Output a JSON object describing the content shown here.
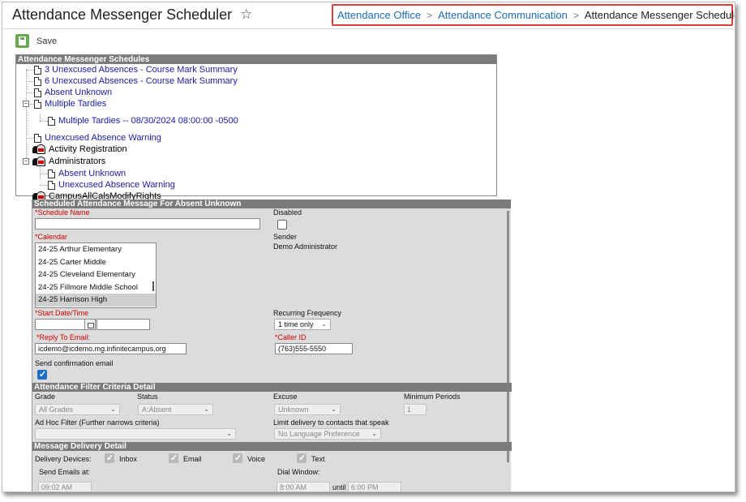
{
  "header": {
    "title": "Attendance Messenger Scheduler",
    "breadcrumb": [
      "Attendance Office",
      "Attendance Communication"
    ],
    "breadcrumb_current": "Attendance Messenger Scheduler"
  },
  "toolbar": {
    "save_label": "Save"
  },
  "schedules": {
    "header": "Attendance Messenger Schedules",
    "items": [
      {
        "label": "3 Unexcused Absences - Course Mark Summary"
      },
      {
        "label": "6 Unexcused Absences - Course Mark Summary"
      },
      {
        "label": "Absent Unknown"
      },
      {
        "label": "Multiple Tardies"
      },
      {
        "label": "Multiple Tardies -- 08/30/2024 08:00:00 -0500"
      },
      {
        "label": "Unexcused Absence Warning"
      },
      {
        "label": "Activity Registration"
      },
      {
        "label": "Administrators"
      },
      {
        "label": "Absent Unknown"
      },
      {
        "label": "Unexcused Absence Warning"
      },
      {
        "label": "CampusAllCalsModifyRights"
      }
    ]
  },
  "detail": {
    "header": "Scheduled Attendance Message For Absent Unknown",
    "schedule_name_label": "*Schedule Name",
    "schedule_name_value": "",
    "disabled_label": "Disabled",
    "calendar_label": "*Calendar",
    "calendars": [
      "24-25 Arthur Elementary",
      "24-25 Carter Middle",
      "24-25 Cleveland Elementary",
      "24-25 Fillmore Middle School",
      "24-25 Harrison High"
    ],
    "sender_label": "Sender",
    "sender_value": "Demo Administrator",
    "start_label": "*Start Date/Time",
    "recurring_label": "Recurring Frequency",
    "recurring_value": "1 time only",
    "reply_label": "*Reply To Email:",
    "reply_value": "icdemo@icdemo.mg.infinitecampus.org",
    "caller_label": "*Caller ID",
    "caller_value": "(763)555-5550",
    "confirm_label": "Send confirmation email"
  },
  "filter": {
    "header": "Attendance Filter Criteria Detail",
    "grade_label": "Grade",
    "grade_value": "All Grades",
    "status_label": "Status",
    "status_value": "A:Absent",
    "excuse_label": "Excuse",
    "excuse_value": "Unknown",
    "min_periods_label": "Minimum Periods",
    "min_periods_value": "1",
    "adhoc_label": "Ad Hoc Filter (Further narrows criteria)",
    "limit_label": "Limit delivery to contacts that speak",
    "limit_value": "No Language Preference"
  },
  "delivery": {
    "header": "Message Delivery Detail",
    "devices_label": "Delivery Devices:",
    "inbox_label": "Inbox",
    "email_label": "Email",
    "voice_label": "Voice",
    "text_label": "Text",
    "send_emails_label": "Send Emails at:",
    "send_emails_value": "09:02 AM",
    "dial_label": "Dial Window:",
    "dial_start": "8:00 AM",
    "until_label": "until",
    "dial_end": "6:00 PM"
  },
  "colors": {
    "link": "#1a1aa6",
    "required": "#d00000",
    "breadcrumb_highlight": "#e23b3b",
    "section_header": "#7b7b7b"
  }
}
